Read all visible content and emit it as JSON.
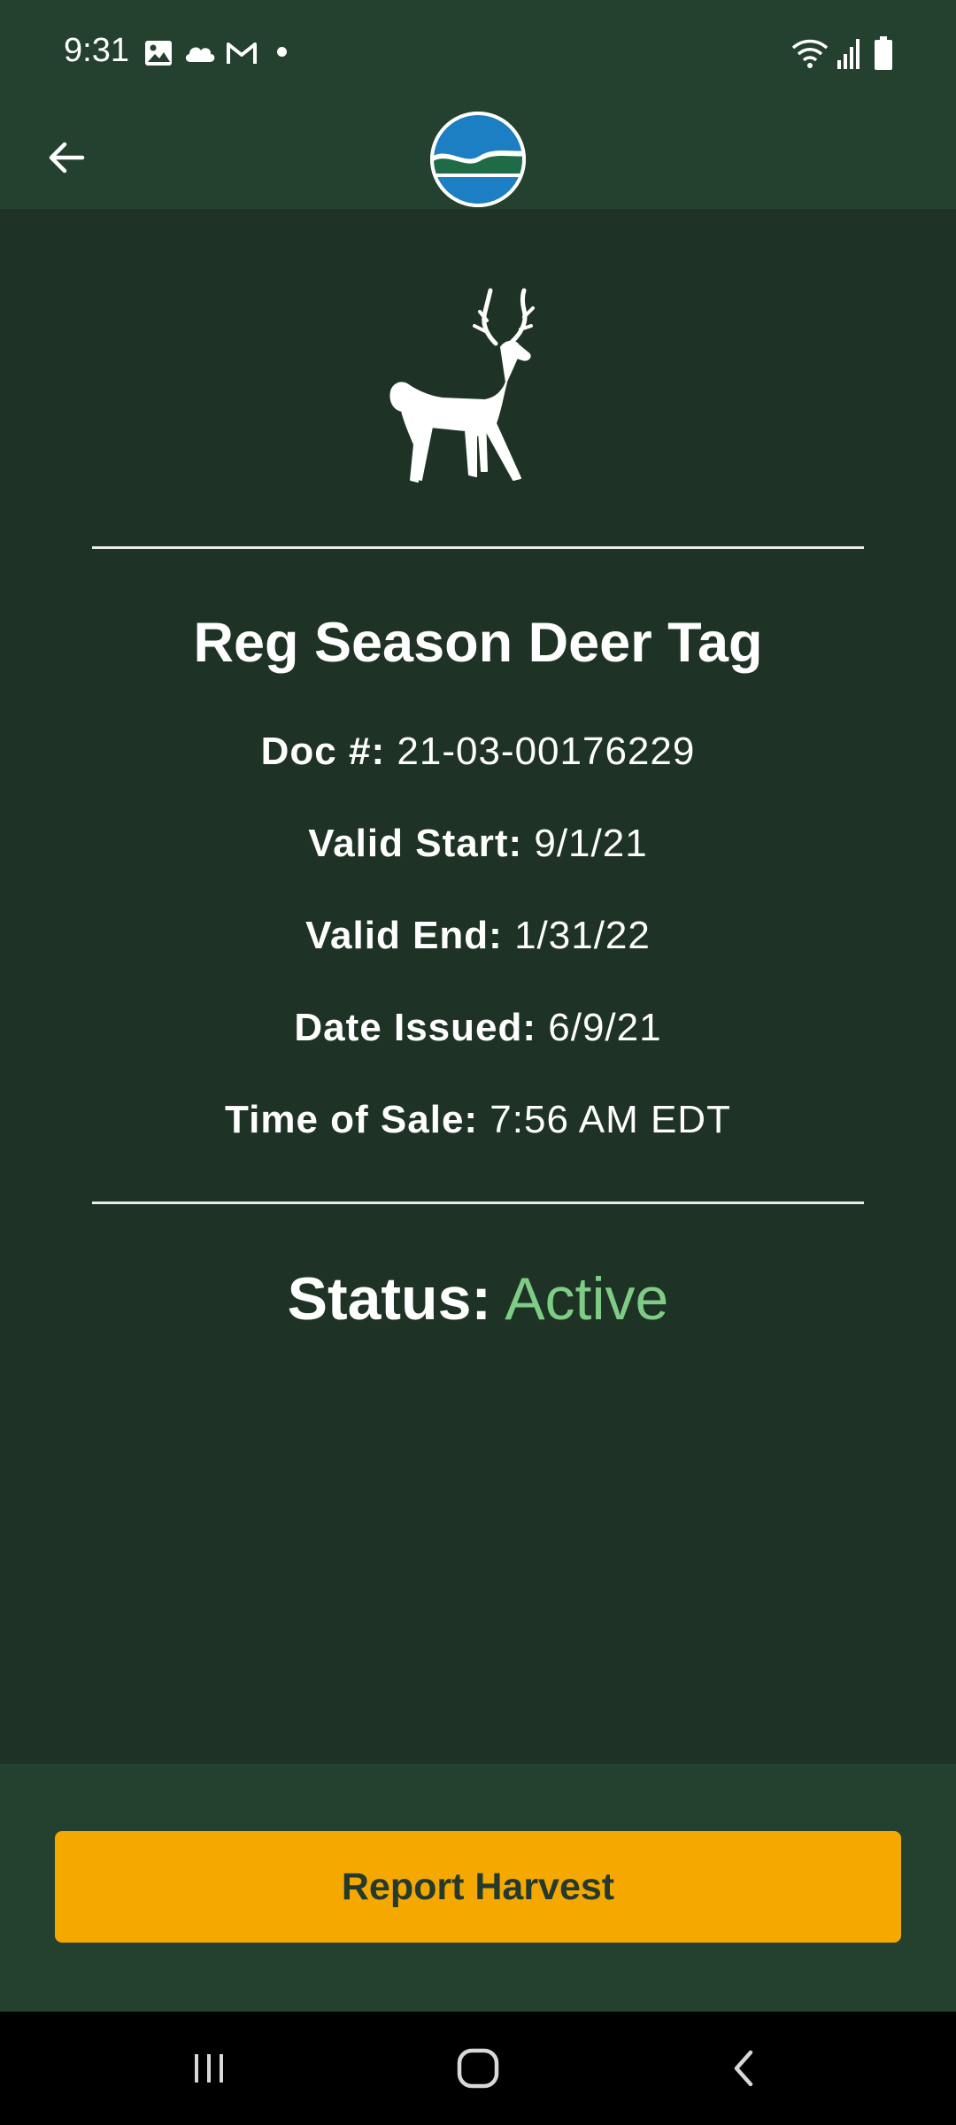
{
  "status_bar": {
    "time": "9:31",
    "left_icons": [
      "image-icon",
      "cloud-icon",
      "gmail-icon",
      "notification-dot"
    ],
    "right_icons": [
      "wifi-icon",
      "signal-icon",
      "battery-icon"
    ]
  },
  "app_bar": {
    "back_icon": "arrow-left-icon",
    "logo": "agency-logo"
  },
  "tag": {
    "icon": "deer-icon",
    "title": "Reg Season Deer Tag",
    "fields": [
      {
        "label": "Doc #:",
        "value": "21-03-00176229"
      },
      {
        "label": "Valid Start:",
        "value": "9/1/21"
      },
      {
        "label": "Valid End:",
        "value": "1/31/22"
      },
      {
        "label": "Date Issued:",
        "value": "6/9/21"
      },
      {
        "label": "Time of Sale:",
        "value": "7:56 AM EDT"
      }
    ],
    "status_label": "Status:",
    "status_value": "Active"
  },
  "actions": {
    "report_harvest": "Report Harvest"
  },
  "nav_bar": [
    "recents-icon",
    "home-icon",
    "back-icon"
  ],
  "colors": {
    "background": "#1e3325",
    "bar": "#24412f",
    "accent": "#f5a800",
    "status_active": "#7fcc86"
  }
}
